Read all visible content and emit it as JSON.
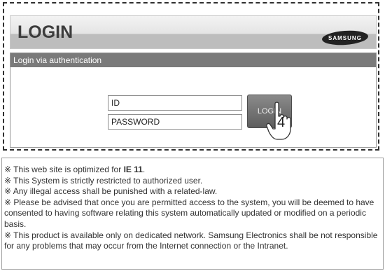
{
  "header": {
    "title": "LOGIN",
    "brand": "SAMSUNG"
  },
  "panel": {
    "title": "Login via authentication",
    "id_value": "ID",
    "password_value": "PASSWORD",
    "login_label": "LOGIN"
  },
  "step_marker": "4",
  "notices": {
    "n1_prefix": "※ This web site is optimized for ",
    "n1_bold": "IE 11",
    "n1_suffix": ".",
    "n2": "※ This System is strictly restricted to authorized user.",
    "n3": "※ Any illegal access shall be punished with a related-law.",
    "n4": "※ Please be advised that once you are permitted access to the system, you will be deemed to have consented to having software relating this system automatically updated or modified on a periodic basis.",
    "n5": "※ This product is available only on dedicated network. Samsung Electronics shall be not responsible for any problems that may occur from the Internet connection or the Intranet."
  }
}
